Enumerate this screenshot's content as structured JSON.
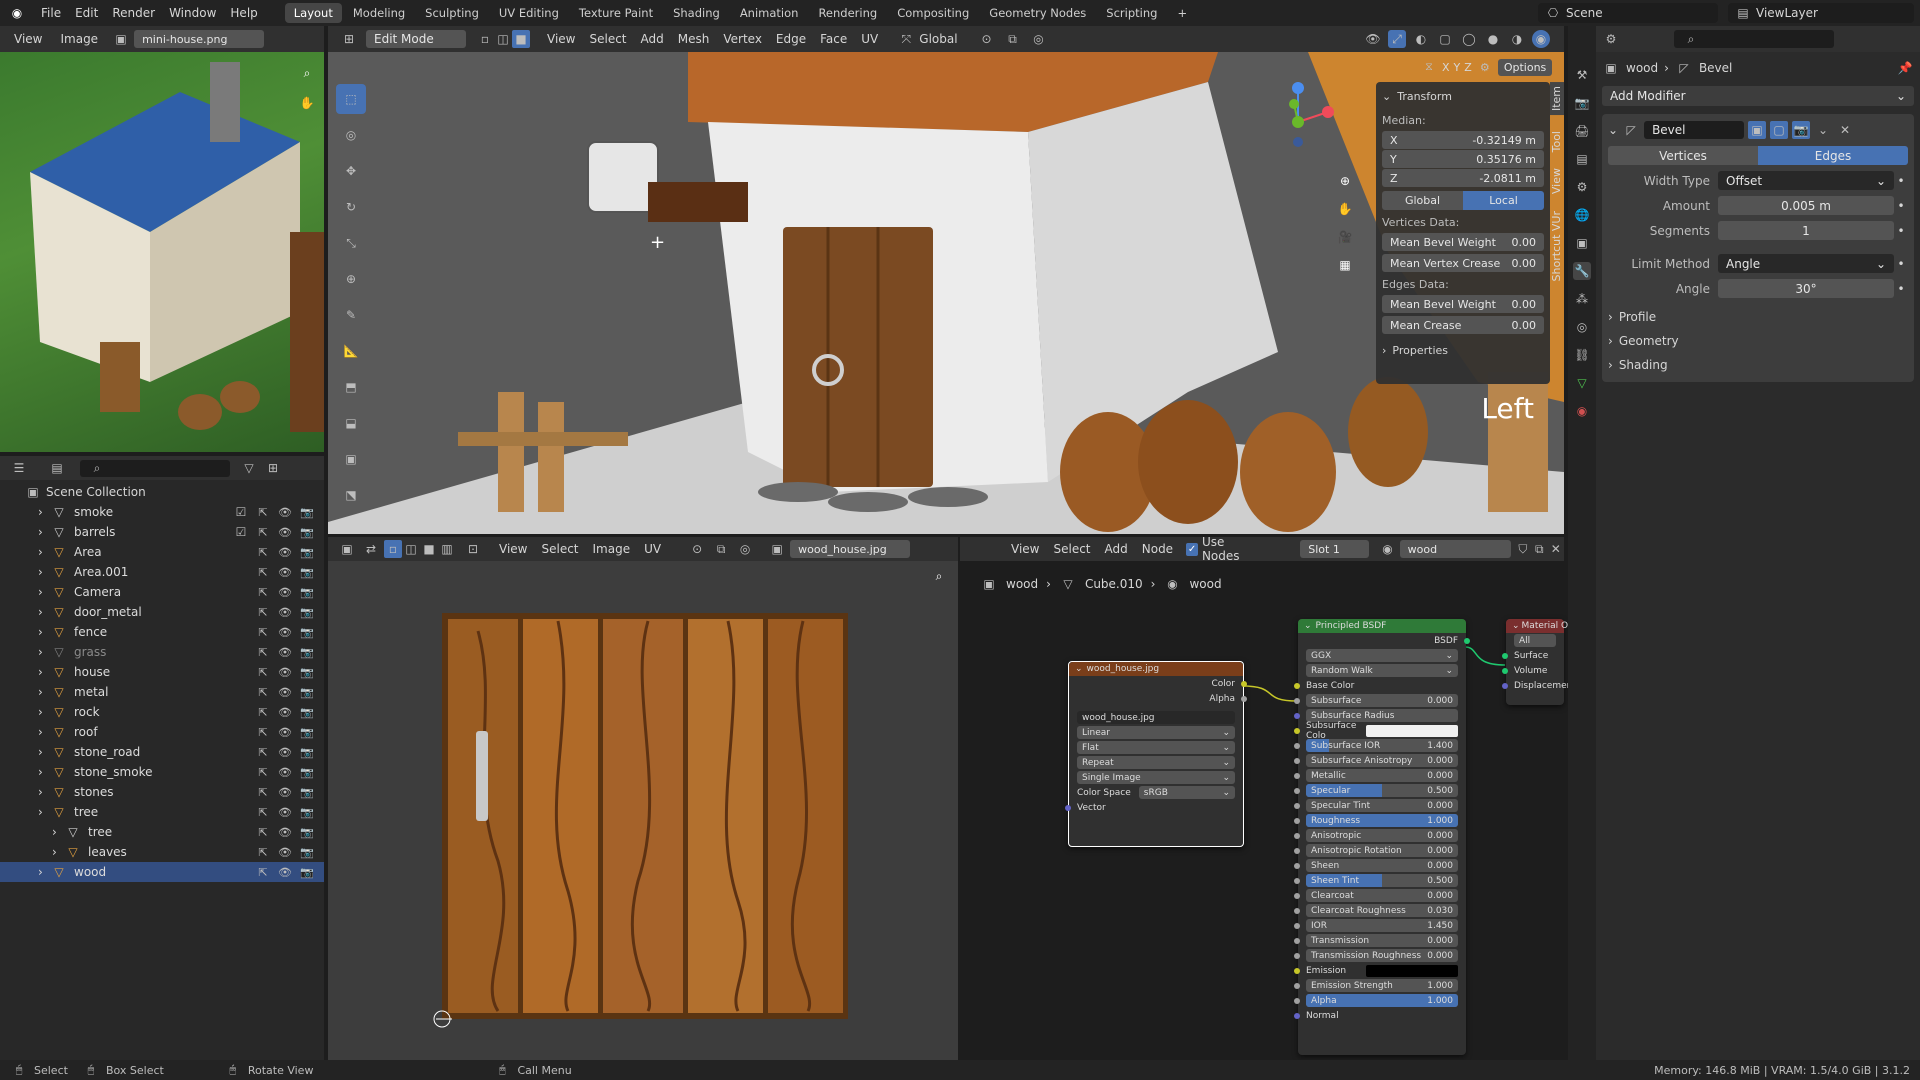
{
  "topbar": {
    "menus": [
      "File",
      "Edit",
      "Render",
      "Window",
      "Help"
    ],
    "workspaces": [
      "Layout",
      "Modeling",
      "Sculpting",
      "UV Editing",
      "Texture Paint",
      "Shading",
      "Animation",
      "Rendering",
      "Compositing",
      "Geometry Nodes",
      "Scripting"
    ],
    "active_workspace": "Layout",
    "add": "+",
    "scene": "Scene",
    "viewlayer": "ViewLayer"
  },
  "image_editor": {
    "menus": [
      "View",
      "Image"
    ],
    "image_name": "mini-house.png"
  },
  "viewport": {
    "mode": "Edit Mode",
    "menus": [
      "View",
      "Select",
      "Add",
      "Mesh",
      "Vertex",
      "Edge",
      "Face",
      "UV"
    ],
    "orientation": "Global",
    "options": "Options",
    "axes": [
      "X",
      "Y",
      "Z"
    ],
    "view_label": "Left",
    "side_tabs": [
      "Item",
      "Tool",
      "View",
      "Shortcut VUr"
    ]
  },
  "transform_panel": {
    "title": "Transform",
    "median": "Median:",
    "x_label": "X",
    "x": "-0.32149 m",
    "y_label": "Y",
    "y": "0.35176 m",
    "z_label": "Z",
    "z": "-2.0811 m",
    "global": "Global",
    "local": "Local",
    "vertices_data": "Vertices Data:",
    "mean_bevel_weight": "Mean Bevel Weight",
    "mbw_v": "0.00",
    "mean_vertex_crease": "Mean Vertex Crease",
    "mvc_v": "0.00",
    "edges_data": "Edges Data:",
    "mean_bevel_weight_e": "Mean Bevel Weight",
    "mbwe_v": "0.00",
    "mean_crease": "Mean Crease",
    "mc_v": "0.00",
    "properties": "Properties"
  },
  "outliner": {
    "title": "Scene Collection",
    "items": [
      {
        "name": "smoke",
        "color": "#c8c8c8",
        "checked": true,
        "indent": 1
      },
      {
        "name": "barrels",
        "color": "#c8c8c8",
        "checked": true,
        "indent": 1
      },
      {
        "name": "Area",
        "color": "#e0a040",
        "indent": 1
      },
      {
        "name": "Area.001",
        "color": "#e0a040",
        "indent": 1
      },
      {
        "name": "Camera",
        "color": "#e0a040",
        "indent": 1
      },
      {
        "name": "door_metal",
        "color": "#e0a040",
        "indent": 1
      },
      {
        "name": "fence",
        "color": "#e0a040",
        "indent": 1
      },
      {
        "name": "grass",
        "color": "#808080",
        "indent": 1
      },
      {
        "name": "house",
        "color": "#e0a040",
        "indent": 1
      },
      {
        "name": "metal",
        "color": "#e0a040",
        "indent": 1
      },
      {
        "name": "rock",
        "color": "#e0a040",
        "indent": 1
      },
      {
        "name": "roof",
        "color": "#e0a040",
        "indent": 1
      },
      {
        "name": "stone_road",
        "color": "#e0a040",
        "indent": 1
      },
      {
        "name": "stone_smoke",
        "color": "#e0a040",
        "indent": 1
      },
      {
        "name": "stones",
        "color": "#e0a040",
        "indent": 1
      },
      {
        "name": "tree",
        "color": "#e0a040",
        "indent": 1
      },
      {
        "name": "tree",
        "color": "#d0d0d0",
        "indent": 2
      },
      {
        "name": "leaves",
        "color": "#e0a040",
        "indent": 2
      },
      {
        "name": "wood",
        "color": "#e0a040",
        "indent": 1,
        "selected": true
      }
    ]
  },
  "uv_editor": {
    "menus": [
      "View",
      "Select",
      "Image",
      "UV"
    ],
    "image": "wood_house.jpg"
  },
  "node_editor": {
    "menus": [
      "View",
      "Select",
      "Add",
      "Node"
    ],
    "use_nodes": "Use Nodes",
    "slot": "Slot 1",
    "material": "wood",
    "breadcrumb": [
      "wood",
      "Cube.010",
      "wood"
    ]
  },
  "image_node": {
    "title": "wood_house.jpg",
    "color": "Color",
    "alpha": "Alpha",
    "image": "wood_house.jpg",
    "interp": "Linear",
    "proj": "Flat",
    "ext": "Repeat",
    "source": "Single Image",
    "cs_label": "Color Space",
    "cs": "sRGB",
    "vector": "Vector"
  },
  "bsdf_node": {
    "title": "Principled BSDF",
    "out": "BSDF",
    "dist": "GGX",
    "sss": "Random Walk",
    "base": "Base Color",
    "rows": [
      {
        "n": "Subsurface",
        "v": "0.000",
        "f": 0
      },
      {
        "n": "Subsurface Radius",
        "v": "",
        "f": 0,
        "drop": true
      },
      {
        "n": "Subsurface Colo",
        "v": "",
        "f": 0,
        "white": true
      },
      {
        "n": "Subsurface IOR",
        "v": "1.400",
        "f": 0.15
      },
      {
        "n": "Subsurface Anisotropy",
        "v": "0.000",
        "f": 0
      },
      {
        "n": "Metallic",
        "v": "0.000",
        "f": 0
      },
      {
        "n": "Specular",
        "v": "0.500",
        "f": 0.5
      },
      {
        "n": "Specular Tint",
        "v": "0.000",
        "f": 0
      },
      {
        "n": "Roughness",
        "v": "1.000",
        "f": 1
      },
      {
        "n": "Anisotropic",
        "v": "0.000",
        "f": 0
      },
      {
        "n": "Anisotropic Rotation",
        "v": "0.000",
        "f": 0
      },
      {
        "n": "Sheen",
        "v": "0.000",
        "f": 0
      },
      {
        "n": "Sheen Tint",
        "v": "0.500",
        "f": 0.5
      },
      {
        "n": "Clearcoat",
        "v": "0.000",
        "f": 0
      },
      {
        "n": "Clearcoat Roughness",
        "v": "0.030",
        "f": 0
      },
      {
        "n": "IOR",
        "v": "1.450",
        "f": 0
      },
      {
        "n": "Transmission",
        "v": "0.000",
        "f": 0
      },
      {
        "n": "Transmission Roughness",
        "v": "0.000",
        "f": 0
      },
      {
        "n": "Emission",
        "v": "",
        "f": 0,
        "black": true
      },
      {
        "n": "Emission Strength",
        "v": "1.000",
        "f": 0
      },
      {
        "n": "Alpha",
        "v": "1.000",
        "f": 1
      },
      {
        "n": "Normal",
        "v": "",
        "f": 0,
        "plain": true
      }
    ]
  },
  "output_node": {
    "title": "Material Output",
    "target": "All",
    "surface": "Surface",
    "volume": "Volume",
    "displacement": "Displacement"
  },
  "properties": {
    "breadcrumb_obj": "wood",
    "breadcrumb_mod": "Bevel",
    "add_modifier": "Add Modifier",
    "modifier": "Bevel",
    "vertices": "Vertices",
    "edges": "Edges",
    "width_type_l": "Width Type",
    "width_type": "Offset",
    "amount_l": "Amount",
    "amount": "0.005 m",
    "segments_l": "Segments",
    "segments": "1",
    "limit_l": "Limit Method",
    "limit": "Angle",
    "angle_l": "Angle",
    "angle": "30°",
    "profile": "Profile",
    "geometry": "Geometry",
    "shading": "Shading"
  },
  "statusbar": {
    "select": "Select",
    "box_select": "Box Select",
    "rotate": "Rotate View",
    "call_menu": "Call Menu",
    "memory": "Memory: 146.8 MiB | VRAM: 1.5/4.0 GiB | 3.1.2"
  }
}
